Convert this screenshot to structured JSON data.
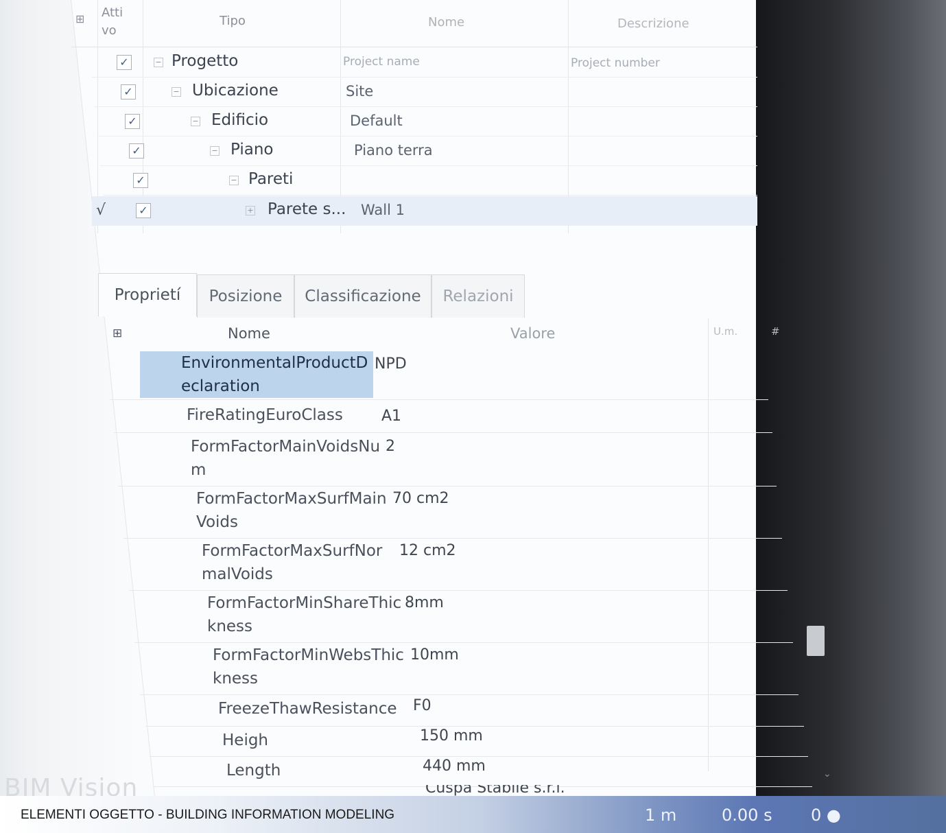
{
  "tree": {
    "headers": {
      "attivo": "Atti vo",
      "tipo": "Tipo",
      "nome": "Nome",
      "descrizione": "Descrizione"
    },
    "rows": [
      {
        "tipo": "Progetto",
        "nome": "Project name",
        "descrizione": "Project number"
      },
      {
        "tipo": "Ubicazione",
        "nome": "Site",
        "descrizione": ""
      },
      {
        "tipo": "Edificio",
        "nome": "Default",
        "descrizione": ""
      },
      {
        "tipo": "Piano",
        "nome": "Piano terra",
        "descrizione": ""
      },
      {
        "tipo": "Pareti",
        "nome": "",
        "descrizione": ""
      },
      {
        "tipo": "Parete s...",
        "nome": "Wall 1",
        "descrizione": "",
        "mark": "√"
      }
    ]
  },
  "tabs": [
    "Proprietí",
    "Posizione",
    "Classificazione",
    "Relazioni"
  ],
  "properties": {
    "headers": {
      "nome": "Nome",
      "valore": "Valore",
      "um": "U.m.",
      "extra": "#"
    },
    "rows": [
      {
        "name": "EnvironmentalProductDeclaration",
        "value": "NPD"
      },
      {
        "name": "FireRatingEuroClass",
        "value": "A1"
      },
      {
        "name": "FormFactorMainVoidsNum",
        "value": "2"
      },
      {
        "name": "FormFactorMaxSurfMainVoids",
        "value": "70 cm2"
      },
      {
        "name": "FormFactorMaxSurfNormalVoids",
        "value": "12 cm2"
      },
      {
        "name": "FormFactorMinShareThickness",
        "value": "8mm"
      },
      {
        "name": "FormFactorMinWebsThickness",
        "value": "10mm"
      },
      {
        "name": "FreezeThawResistance",
        "value": "F0"
      },
      {
        "name": "Heigh",
        "value": "150 mm"
      },
      {
        "name": "Length",
        "value": "440 mm"
      },
      {
        "name": "",
        "value": "Cuspa Stabile s.r.l."
      }
    ]
  },
  "watermark": "BIM Vision",
  "status": {
    "title": "ELEMENTI OGGETTO - BUILDING INFORMATION MODELING",
    "scale": "1 m",
    "time": "0.00 s",
    "count": "0 ●"
  }
}
